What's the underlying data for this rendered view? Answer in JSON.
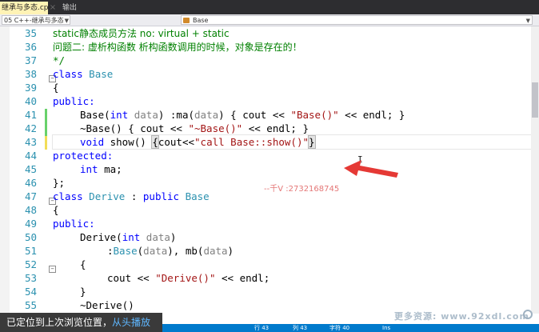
{
  "tabs": {
    "active_label": "继承与多态.cpp*",
    "second_label": "输出"
  },
  "navbar": {
    "project": "05 C++-继承与多态",
    "scope": "Base"
  },
  "editor": {
    "line_numbers": [
      "35",
      "36",
      "37",
      "38",
      "39",
      "40",
      "41",
      "42",
      "43",
      "44",
      "45",
      "46",
      "47",
      "48",
      "49",
      "50",
      "51",
      "52",
      "53",
      "54",
      "55"
    ],
    "line35": "static静态成员方法 no: virtual + static",
    "line36": "问题二: 虚析构函数 析构函数调用的时候，对象是存在的！",
    "line37": "*/",
    "kw_class": "class",
    "class_base": "Base",
    "brace_open": "{",
    "brace_close": "}",
    "kw_public": "public:",
    "kw_protected": "protected:",
    "line41": {
      "a": "Base(",
      "kw_int": "int",
      "p1": " data",
      "b": ") :ma(",
      "p2": "data",
      "c": ") { cout << ",
      "s": "\"Base()\"",
      "d": " << endl; }"
    },
    "line42": {
      "a": "~Base() { cout << ",
      "s": "\"~Base()\"",
      "d": " << endl; }"
    },
    "line43": {
      "kw_void": "void",
      "a": " show() ",
      "br": "{",
      "b": "cout<<",
      "s": "\"call Base::show()\"",
      "br2": "}"
    },
    "line45": {
      "kw_int": "int",
      "a": " ma;"
    },
    "line46": "};",
    "line47": {
      "kw_class": "class",
      "name": "Derive",
      "a": " : ",
      "kw_public": "public",
      "base": "Base"
    },
    "line50": {
      "a": "Derive(",
      "kw_int": "int",
      "p": " data",
      "b": ")"
    },
    "line51": {
      "a": ":",
      "base": "Base",
      "b": "(",
      "p1": "data",
      "c": "), mb(",
      "p2": "data",
      "d": ")"
    },
    "line53": {
      "a": "cout << ",
      "s": "\"Derive()\"",
      "b": " << endl;"
    },
    "line55": "~Derive()"
  },
  "overlay": {
    "watermark": "--千V :2732168745",
    "site": "更多资源: www.92xdl.com"
  },
  "status": {
    "row": "行 43",
    "col": "列 43",
    "ch": "字符 40",
    "ins": "Ins"
  },
  "toast": {
    "text": "已定位到上次浏览位置，",
    "link": "从头播放"
  },
  "colors": {
    "keyword": "#0000ff",
    "type": "#2b91af",
    "string": "#a31515",
    "comment": "#008000",
    "statusbar": "#007acc",
    "arrow": "#e53935"
  }
}
